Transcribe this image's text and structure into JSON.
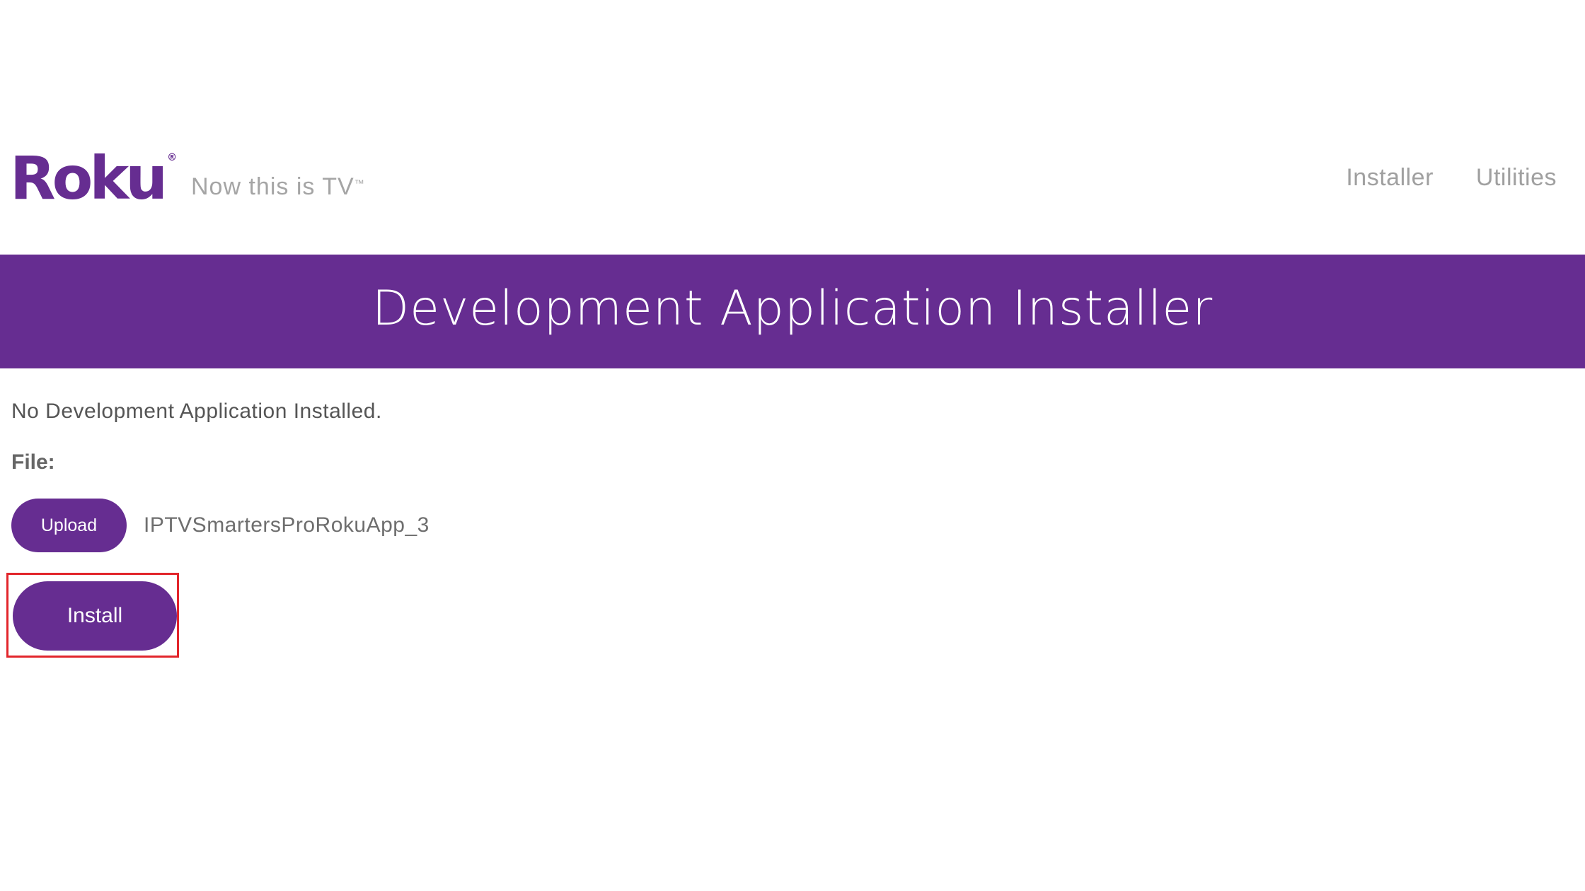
{
  "header": {
    "logo_text": "Roku",
    "logo_mark": "®",
    "tagline": "Now this is TV",
    "tagline_mark": "™",
    "nav": [
      {
        "label": "Installer"
      },
      {
        "label": "Utilities"
      }
    ]
  },
  "banner": {
    "title": "Development Application Installer"
  },
  "main": {
    "status": "No Development Application Installed.",
    "file_label": "File:",
    "upload_label": "Upload",
    "file_name": "IPTVSmartersProRokuApp_3",
    "install_label": "Install"
  },
  "colors": {
    "brand_purple": "#662d91",
    "highlight_red": "#e2252b"
  }
}
